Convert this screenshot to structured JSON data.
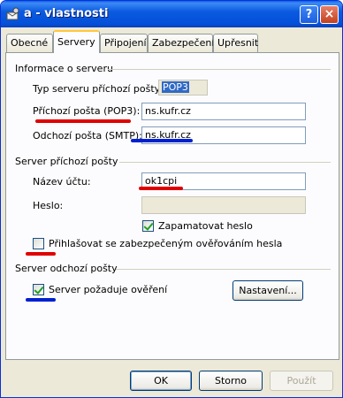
{
  "window": {
    "title": "a - vlastnosti",
    "help_icon": "?",
    "close_icon": "×"
  },
  "tabs": [
    {
      "label": "Obecné",
      "active": false
    },
    {
      "label": "Servery",
      "active": true
    },
    {
      "label": "Připojení",
      "active": false
    },
    {
      "label": "Zabezpečení",
      "active": false
    },
    {
      "label": "Upřesnit",
      "active": false
    }
  ],
  "server_info": {
    "heading": "Informace o serveru",
    "incoming_type_label": "Typ serveru příchozí pošty:",
    "incoming_type_value": "POP3",
    "incoming_label": "Příchozí pošta (POP3):",
    "incoming_value": "ns.kufr.cz",
    "outgoing_label": "Odchozí pošta (SMTP):",
    "outgoing_value": "ns.kufr.cz"
  },
  "incoming_server": {
    "heading": "Server příchozí pošty",
    "account_label": "Název účtu:",
    "account_value": "ok1cpi",
    "password_label": "Heslo:",
    "password_value": "",
    "remember_label": "Zapamatovat heslo",
    "remember_checked": true,
    "spa_label": "Přihlašovat se zabezpečeným ověřováním hesla",
    "spa_checked": false
  },
  "outgoing_server": {
    "heading": "Server odchozí pošty",
    "auth_label": "Server požaduje ověření",
    "auth_checked": true,
    "settings_button": "Nastavení..."
  },
  "footer": {
    "ok": "OK",
    "cancel": "Storno",
    "apply": "Použít"
  },
  "colors": {
    "red_mark": "#e00000",
    "blue_mark": "#0020d0"
  }
}
